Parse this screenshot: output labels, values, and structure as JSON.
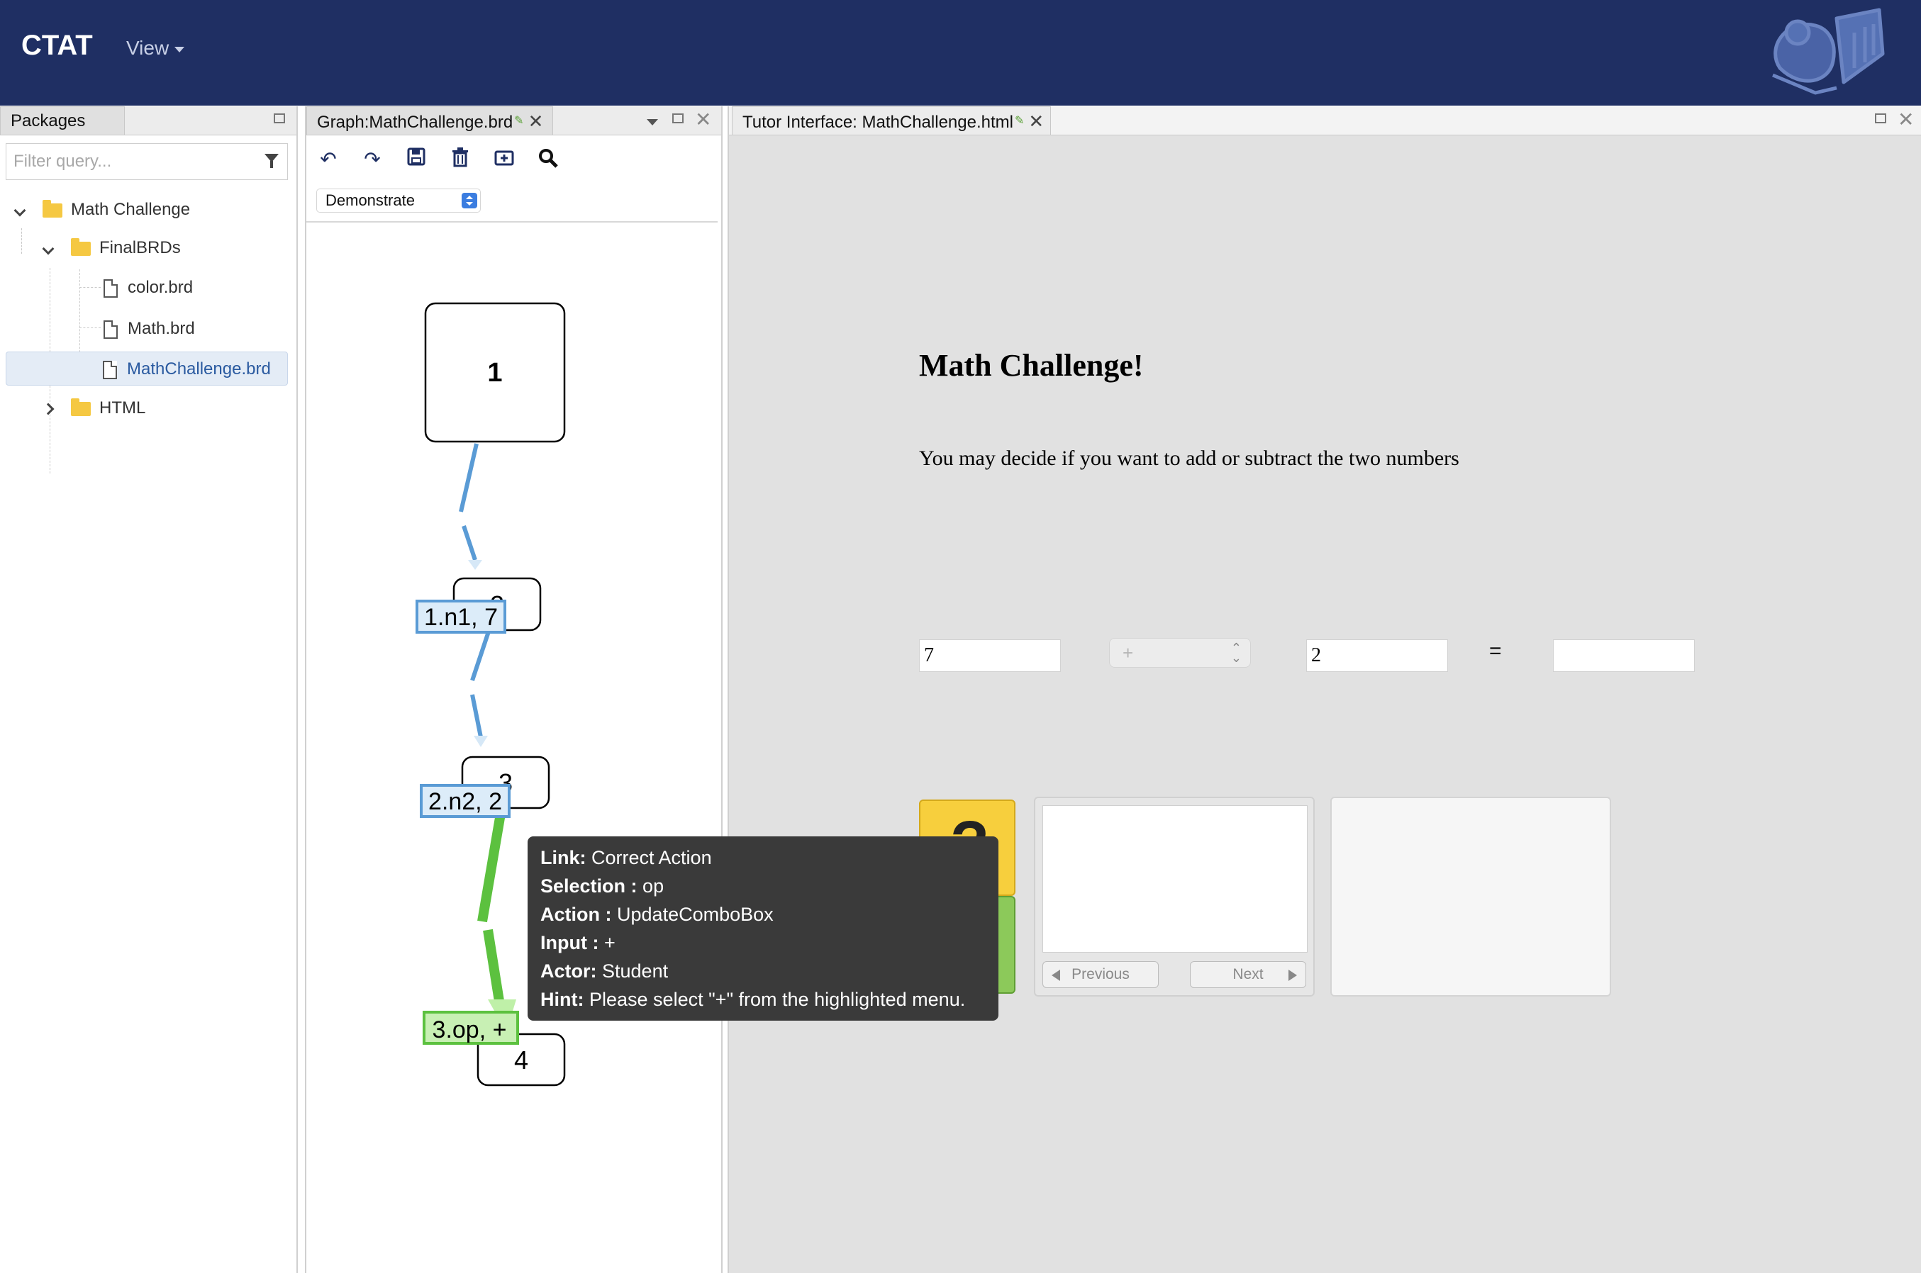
{
  "app": {
    "brand": "CTAT",
    "view_menu": "View"
  },
  "packages": {
    "tab": "Packages",
    "filter_placeholder": "Filter query...",
    "tree": {
      "root": "Math Challenge",
      "folder1": "FinalBRDs",
      "files": [
        "color.brd",
        "Math.brd",
        "MathChallenge.brd"
      ],
      "folder2": "HTML"
    }
  },
  "graph": {
    "tab": "Graph:MathChallenge.brd",
    "mode": "Demonstrate",
    "nodes": [
      "1",
      "2",
      "3",
      "4"
    ],
    "edges": [
      "1.n1, 7",
      "2.n2, 2",
      "3.op, +"
    ]
  },
  "tutor": {
    "tab": "Tutor Interface: MathChallenge.html",
    "title": "Math Challenge!",
    "instructions": "You may decide if you want to add or subtract the two numbers",
    "n1": "7",
    "op": "+",
    "n2": "2",
    "equals": "=",
    "answer": "",
    "help_label": "?",
    "prev_label": "Previous",
    "next_label": "Next"
  },
  "tooltip": {
    "link_label": "Link:",
    "link_value": "Correct Action",
    "selection_label": "Selection :",
    "selection_value": "op",
    "action_label": "Action :",
    "action_value": "UpdateComboBox",
    "input_label": "Input :",
    "input_value": "+",
    "actor_label": "Actor:",
    "actor_value": "Student",
    "hint_label": "Hint:",
    "hint_value": "Please select \"+\" from the highlighted menu."
  },
  "colors": {
    "header": "#1f2f63",
    "edge_blue": "#5a9bd5",
    "edge_green": "#5cc13f",
    "help_yellow": "#f7cf3d",
    "done_green": "#8cc95a"
  }
}
